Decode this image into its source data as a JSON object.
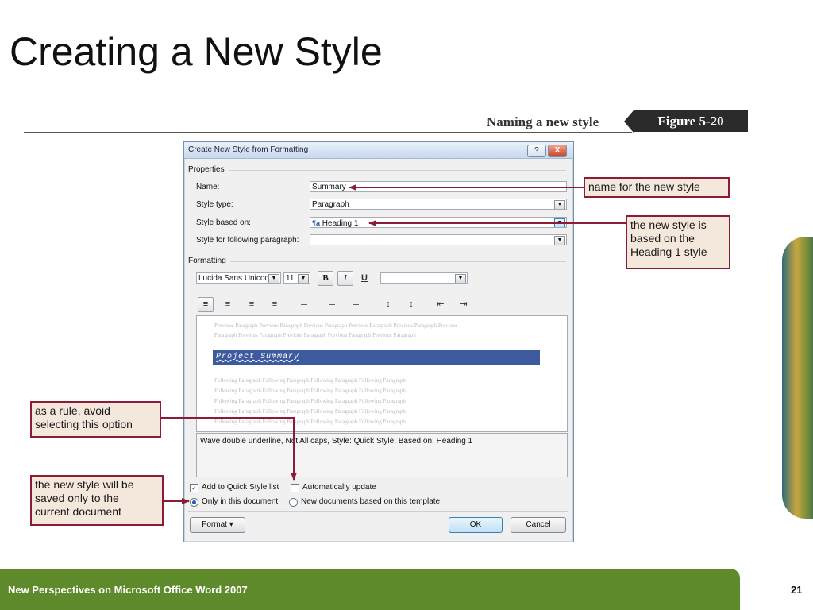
{
  "slide": {
    "title": "Creating a New Style",
    "figure_caption": "Naming a new style",
    "figure_number": "Figure  5-20",
    "footer": "New Perspectives on Microsoft Office Word 2007",
    "page_number": "21"
  },
  "dialog": {
    "title": "Create New Style from Formatting",
    "help_label": "?",
    "close_label": "X",
    "properties_heading": "Properties",
    "name_label": "Name:",
    "name_value": "Summary",
    "style_type_label": "Style type:",
    "style_type_value": "Paragraph",
    "based_on_label": "Style based on:",
    "based_on_value": "Heading 1",
    "following_label": "Style for following paragraph:",
    "following_value": "",
    "formatting_heading": "Formatting",
    "font_value": "Lucida Sans Unicod",
    "size_value": "11",
    "bold_label": "B",
    "italic_label": "I",
    "underline_label": "U",
    "color_value": "",
    "preview": {
      "previous_line1": "Previous Paragraph Previous Paragraph Previous Paragraph Previous Paragraph Previous Paragraph Previous",
      "previous_line2": "Paragraph Previous Paragraph Previous Paragraph Previous Paragraph Previous Paragraph",
      "sample": "Project Summary",
      "following_lines": [
        "Following Paragraph Following Paragraph Following Paragraph Following Paragraph",
        "Following Paragraph Following Paragraph Following Paragraph Following Paragraph",
        "Following Paragraph Following Paragraph Following Paragraph Following Paragraph",
        "Following Paragraph Following Paragraph Following Paragraph Following Paragraph",
        "Following Paragraph Following Paragraph Following Paragraph Following Paragraph"
      ]
    },
    "description": "Wave double underline, Not All caps, Style: Quick Style, Based on: Heading 1",
    "add_quick_style_label": "Add to Quick Style list",
    "add_quick_style_checked": true,
    "auto_update_label": "Automatically update",
    "auto_update_checked": false,
    "only_document_label": "Only in this document",
    "new_documents_label": "New documents based on this template",
    "format_button_label": "Format ▾",
    "ok_label": "OK",
    "cancel_label": "Cancel"
  },
  "callouts": {
    "name": "name for the new style",
    "based_on_l1": "the new style is",
    "based_on_l2": "based on the",
    "based_on_l3": "Heading 1 style",
    "avoid_l1": "as a rule, avoid",
    "avoid_l2": "selecting this option",
    "saved_l1": "the new style will be",
    "saved_l2": "saved only to the",
    "saved_l3": "current document"
  },
  "colors": {
    "callout_border": "#8b1b36",
    "callout_fill": "#f4e7dc",
    "footer_green": "#5f8a2c",
    "sample_bar": "#3e5a9e"
  },
  "icons": [
    "help-icon",
    "close-icon",
    "dropdown-arrow-icon",
    "align-left-icon",
    "align-center-icon",
    "align-right-icon",
    "justify-icon",
    "line-spacing-icon",
    "paragraph-spacing-icon",
    "indent-decrease-icon",
    "indent-increase-icon",
    "heading-style-icon"
  ]
}
